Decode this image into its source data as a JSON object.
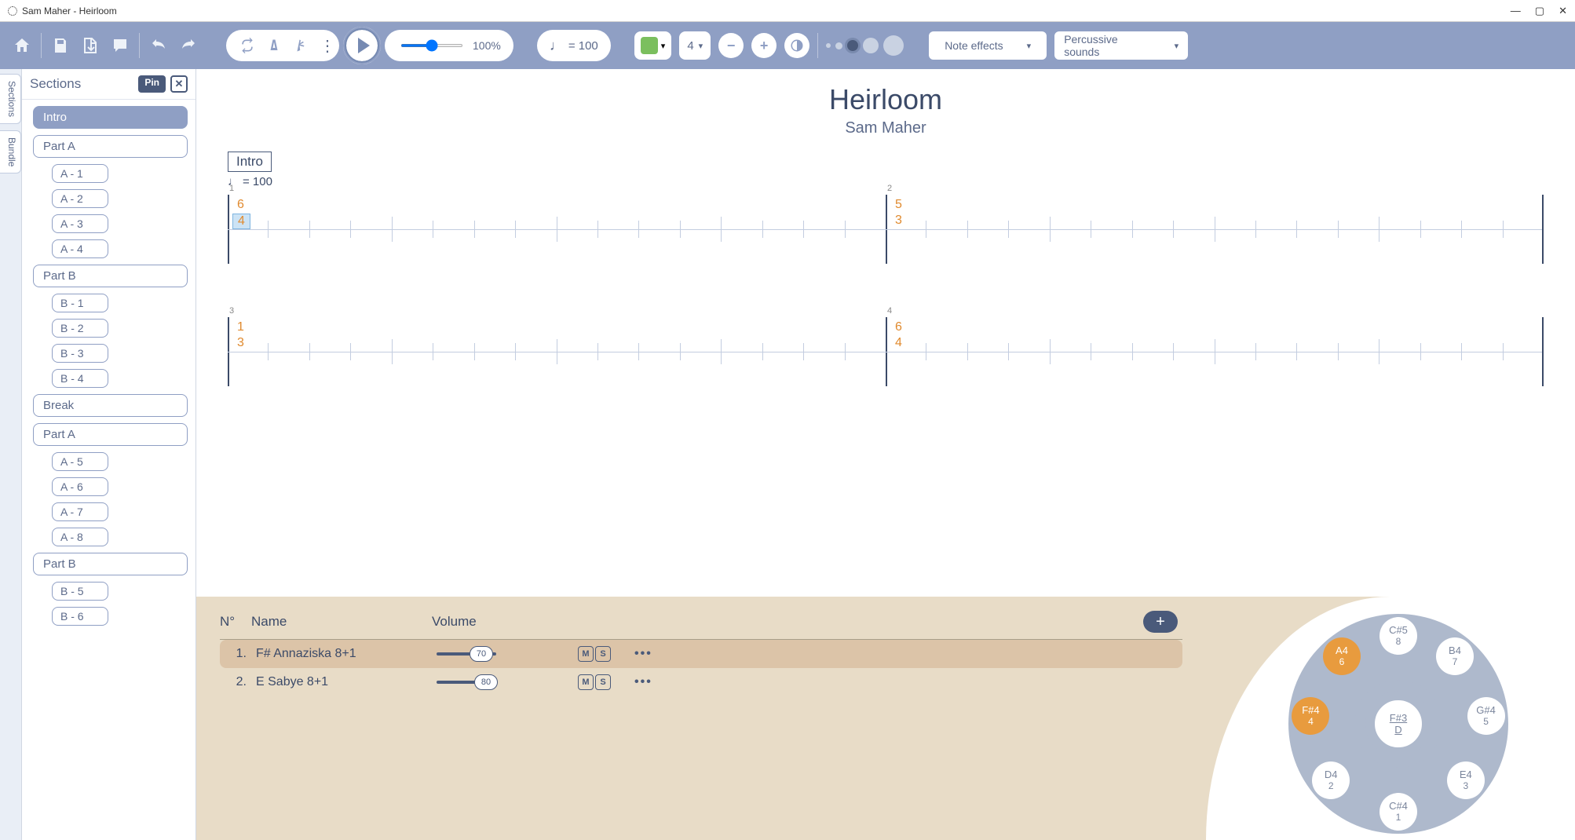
{
  "window": {
    "title": "Sam Maher - Heirloom"
  },
  "toolbar": {
    "speed_pct": "100%",
    "tempo_eq": "= 100",
    "beats": "4",
    "note_effects": "Note effects",
    "percussive": "Percussive sounds"
  },
  "sidebar": {
    "title": "Sections",
    "pin": "Pin",
    "tabs": {
      "sections": "Sections",
      "bundle": "Bundle"
    },
    "items": [
      {
        "label": "Intro",
        "active": true,
        "subs": []
      },
      {
        "label": "Part A",
        "subs": [
          "A - 1",
          "A - 2",
          "A - 3",
          "A - 4"
        ]
      },
      {
        "label": "Part B",
        "subs": [
          "B - 1",
          "B - 2",
          "B - 3",
          "B - 4"
        ]
      },
      {
        "label": "Break",
        "subs": []
      },
      {
        "label": "Part A",
        "subs": [
          "A - 5",
          "A - 6",
          "A - 7",
          "A - 8"
        ]
      },
      {
        "label": "Part B",
        "subs": [
          "B - 5",
          "B - 6"
        ]
      }
    ]
  },
  "score": {
    "title": "Heirloom",
    "artist": "Sam Maher",
    "section_label": "Intro",
    "tempo_text": "= 100",
    "measures": [
      {
        "num": "1",
        "notes": [
          "6",
          "4"
        ],
        "selected_index": 1
      },
      {
        "num": "2",
        "notes": [
          "5",
          "3"
        ]
      },
      {
        "num": "3",
        "notes": [
          "1",
          "3"
        ]
      },
      {
        "num": "4",
        "notes": [
          "6",
          "4"
        ]
      }
    ]
  },
  "instruments": {
    "headers": {
      "num": "N°",
      "name": "Name",
      "volume": "Volume"
    },
    "rows": [
      {
        "num": "1.",
        "name": "F# Annaziska 8+1",
        "vol": "70",
        "selected": true
      },
      {
        "num": "2.",
        "name": "E Sabye 8+1",
        "vol": "80",
        "selected": false
      }
    ],
    "ms": {
      "m": "M",
      "s": "S"
    }
  },
  "handpan": {
    "ding": {
      "name": "F#3",
      "sub": "D"
    },
    "tones": [
      {
        "name": "C#5",
        "num": "8",
        "angle": -90,
        "hl": false
      },
      {
        "name": "B4",
        "num": "7",
        "angle": -50,
        "hl": false
      },
      {
        "name": "G#4",
        "num": "5",
        "angle": -5,
        "hl": false
      },
      {
        "name": "E4",
        "num": "3",
        "angle": 40,
        "hl": false
      },
      {
        "name": "C#4",
        "num": "1",
        "angle": 90,
        "hl": false
      },
      {
        "name": "D4",
        "num": "2",
        "angle": 140,
        "hl": false
      },
      {
        "name": "F#4",
        "num": "4",
        "angle": 185,
        "hl": true
      },
      {
        "name": "A4",
        "num": "6",
        "angle": 230,
        "hl": true
      }
    ]
  }
}
